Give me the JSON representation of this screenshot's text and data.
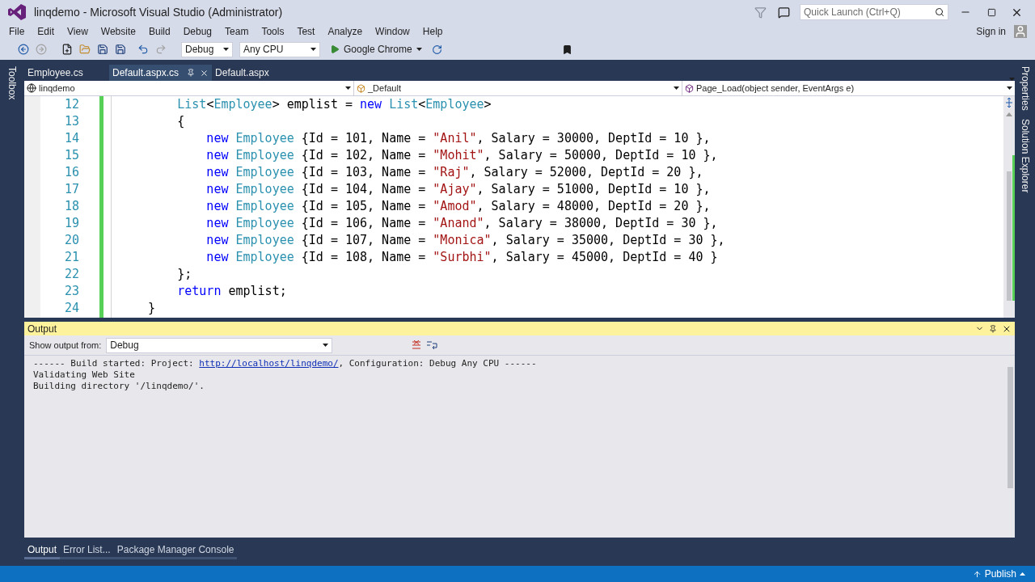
{
  "window": {
    "title": "linqdemo - Microsoft Visual Studio (Administrator)",
    "quick_launch_placeholder": "Quick Launch (Ctrl+Q)",
    "sign_in": "Sign in"
  },
  "menu": [
    "File",
    "Edit",
    "View",
    "Website",
    "Build",
    "Debug",
    "Team",
    "Tools",
    "Test",
    "Analyze",
    "Window",
    "Help"
  ],
  "toolbar": {
    "configuration": "Debug",
    "platform": "Any CPU",
    "run_target": "Google Chrome"
  },
  "left_side_tabs": [
    "Toolbox"
  ],
  "right_side_tabs": [
    "Properties",
    "Solution Explorer"
  ],
  "doc_tabs": [
    {
      "label": "Employee.cs",
      "selected": false,
      "closable": false
    },
    {
      "label": "Default.aspx.cs",
      "selected": true,
      "closable": true
    },
    {
      "label": "Default.aspx",
      "selected": false,
      "closable": false
    }
  ],
  "nav_bar": {
    "project": "linqdemo",
    "class": "_Default",
    "member": "Page_Load(object sender, EventArgs e)"
  },
  "code_lines": [
    {
      "number": "12",
      "segments": [
        {
          "kind": "type",
          "text": "        List"
        },
        {
          "kind": "plain",
          "text": "<"
        },
        {
          "kind": "type",
          "text": "Employee"
        },
        {
          "kind": "plain",
          "text": "> emplist = "
        },
        {
          "kind": "keyword",
          "text": "new "
        },
        {
          "kind": "type",
          "text": "List"
        },
        {
          "kind": "plain",
          "text": "<"
        },
        {
          "kind": "type",
          "text": "Employee"
        },
        {
          "kind": "plain",
          "text": ">"
        }
      ]
    },
    {
      "number": "13",
      "segments": [
        {
          "kind": "plain",
          "text": "        {"
        }
      ]
    },
    {
      "number": "14",
      "segments": [
        {
          "kind": "keyword",
          "text": "            new "
        },
        {
          "kind": "type",
          "text": "Employee"
        },
        {
          "kind": "plain",
          "text": " {Id = 101, Name = "
        },
        {
          "kind": "string",
          "text": "\"Anil\""
        },
        {
          "kind": "plain",
          "text": ", Salary = 30000, DeptId = 10 },"
        }
      ]
    },
    {
      "number": "15",
      "segments": [
        {
          "kind": "keyword",
          "text": "            new "
        },
        {
          "kind": "type",
          "text": "Employee"
        },
        {
          "kind": "plain",
          "text": " {Id = 102, Name = "
        },
        {
          "kind": "string",
          "text": "\"Mohit\""
        },
        {
          "kind": "plain",
          "text": ", Salary = 50000, DeptId = 10 },"
        }
      ]
    },
    {
      "number": "16",
      "segments": [
        {
          "kind": "keyword",
          "text": "            new "
        },
        {
          "kind": "type",
          "text": "Employee"
        },
        {
          "kind": "plain",
          "text": " {Id = 103, Name = "
        },
        {
          "kind": "string",
          "text": "\"Raj\""
        },
        {
          "kind": "plain",
          "text": ", Salary = 52000, DeptId = 20 },"
        }
      ]
    },
    {
      "number": "17",
      "segments": [
        {
          "kind": "keyword",
          "text": "            new "
        },
        {
          "kind": "type",
          "text": "Employee"
        },
        {
          "kind": "plain",
          "text": " {Id = 104, Name = "
        },
        {
          "kind": "string",
          "text": "\"Ajay\""
        },
        {
          "kind": "plain",
          "text": ", Salary = 51000, DeptId = 10 },"
        }
      ]
    },
    {
      "number": "18",
      "segments": [
        {
          "kind": "keyword",
          "text": "            new "
        },
        {
          "kind": "type",
          "text": "Employee"
        },
        {
          "kind": "plain",
          "text": " {Id = 105, Name = "
        },
        {
          "kind": "string",
          "text": "\"Amod\""
        },
        {
          "kind": "plain",
          "text": ", Salary = 48000, DeptId = 20 },"
        }
      ]
    },
    {
      "number": "19",
      "segments": [
        {
          "kind": "keyword",
          "text": "            new "
        },
        {
          "kind": "type",
          "text": "Employee"
        },
        {
          "kind": "plain",
          "text": " {Id = 106, Name = "
        },
        {
          "kind": "string",
          "text": "\"Anand\""
        },
        {
          "kind": "plain",
          "text": ", Salary = 38000, DeptId = 30 },"
        }
      ]
    },
    {
      "number": "20",
      "segments": [
        {
          "kind": "keyword",
          "text": "            new "
        },
        {
          "kind": "type",
          "text": "Employee"
        },
        {
          "kind": "plain",
          "text": " {Id = 107, Name = "
        },
        {
          "kind": "string",
          "text": "\"Monica\""
        },
        {
          "kind": "plain",
          "text": ", Salary = 35000, DeptId = 30 },"
        }
      ]
    },
    {
      "number": "21",
      "segments": [
        {
          "kind": "keyword",
          "text": "            new "
        },
        {
          "kind": "type",
          "text": "Employee"
        },
        {
          "kind": "plain",
          "text": " {Id = 108, Name = "
        },
        {
          "kind": "string",
          "text": "\"Surbhi\""
        },
        {
          "kind": "plain",
          "text": ", Salary = 45000, DeptId = 40 }"
        }
      ]
    },
    {
      "number": "22",
      "segments": [
        {
          "kind": "plain",
          "text": "        };"
        }
      ]
    },
    {
      "number": "23",
      "segments": [
        {
          "kind": "keyword",
          "text": "        return"
        },
        {
          "kind": "plain",
          "text": " emplist;"
        }
      ]
    },
    {
      "number": "24",
      "segments": [
        {
          "kind": "plain",
          "text": "    }"
        }
      ]
    }
  ],
  "output": {
    "title": "Output",
    "source_label": "Show output from:",
    "source": "Debug",
    "lines": [
      [
        {
          "kind": "plain",
          "text": "------ Build started: Project: "
        },
        {
          "kind": "link",
          "text": "http://localhost/linqdemo/"
        },
        {
          "kind": "plain",
          "text": ", Configuration: Debug Any CPU ------"
        }
      ],
      [
        {
          "kind": "plain",
          "text": "Validating Web Site"
        }
      ],
      [
        {
          "kind": "plain",
          "text": "Building directory '/linqdemo/'."
        }
      ]
    ]
  },
  "bottom_tabs": [
    {
      "label": "Output",
      "selected": true
    },
    {
      "label": "Error List...",
      "selected": false
    },
    {
      "label": "Package Manager Console",
      "selected": false
    }
  ],
  "status_bar": {
    "publish": "Publish"
  }
}
